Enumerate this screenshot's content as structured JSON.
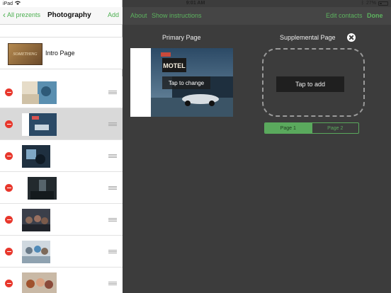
{
  "status": {
    "device": "iPad",
    "time": "9:01 AM",
    "battery": "27%"
  },
  "left_nav": {
    "back_label": "All prezents",
    "title": "Photography",
    "add_label": "Add"
  },
  "intro": {
    "label": "Intro Page",
    "thumb_text": "SOMETHING"
  },
  "right_nav": {
    "about": "About",
    "instructions": "Show instructions",
    "edit_contacts": "Edit contacts",
    "done": "Done"
  },
  "primary": {
    "label": "Primary Page",
    "tap_change": "Tap to change",
    "sign_text": "MOTEL"
  },
  "supplemental": {
    "label": "Supplemental Page",
    "tap_add": "Tap to add"
  },
  "pages": {
    "page1": "Page 1",
    "page2": "Page 2",
    "selected": "Page 1"
  },
  "colors": {
    "accent": "#4caf50",
    "delete": "#e8372c",
    "dark_bg": "#3c3c3c"
  }
}
